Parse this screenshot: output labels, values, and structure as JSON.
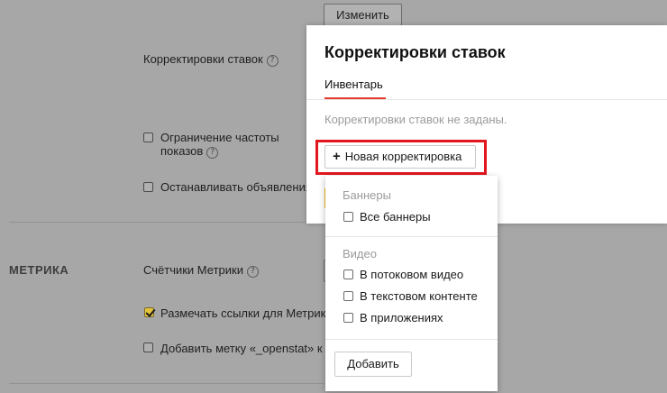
{
  "background": {
    "change_button": "Изменить",
    "bid_adjustments_label": "Корректировки ставок",
    "frequency_cap_label_line1": "Ограничение частоты",
    "frequency_cap_label_line2": "показов",
    "stop_ads_label": "Останавливать объявления",
    "metrika_section": "МЕТРИКА",
    "metrika_counters_label": "Счётчики Метрики",
    "mark_links_label": "Размечать ссылки для Метрики",
    "openstat_label": "Добавить метку «_openstat» к",
    "help_glyph": "?",
    "colors": {
      "overlay": "#a7a7a7",
      "checked": "#e4c33b"
    }
  },
  "modal": {
    "title": "Корректировки ставок",
    "tab": "Инвентарь",
    "empty_text": "Корректировки ставок не заданы.",
    "new_button_plus": "+",
    "new_button": "Новая корректировка",
    "colors": {
      "tab_accent": "#e63b2e",
      "highlight": "#e2161e"
    }
  },
  "dropdown": {
    "banners_group": "Баннеры",
    "banners_options": [
      "Все баннеры"
    ],
    "video_group": "Видео",
    "video_options": [
      "В потоковом видео",
      "В текстовом контенте",
      "В приложениях"
    ],
    "add_button": "Добавить"
  }
}
